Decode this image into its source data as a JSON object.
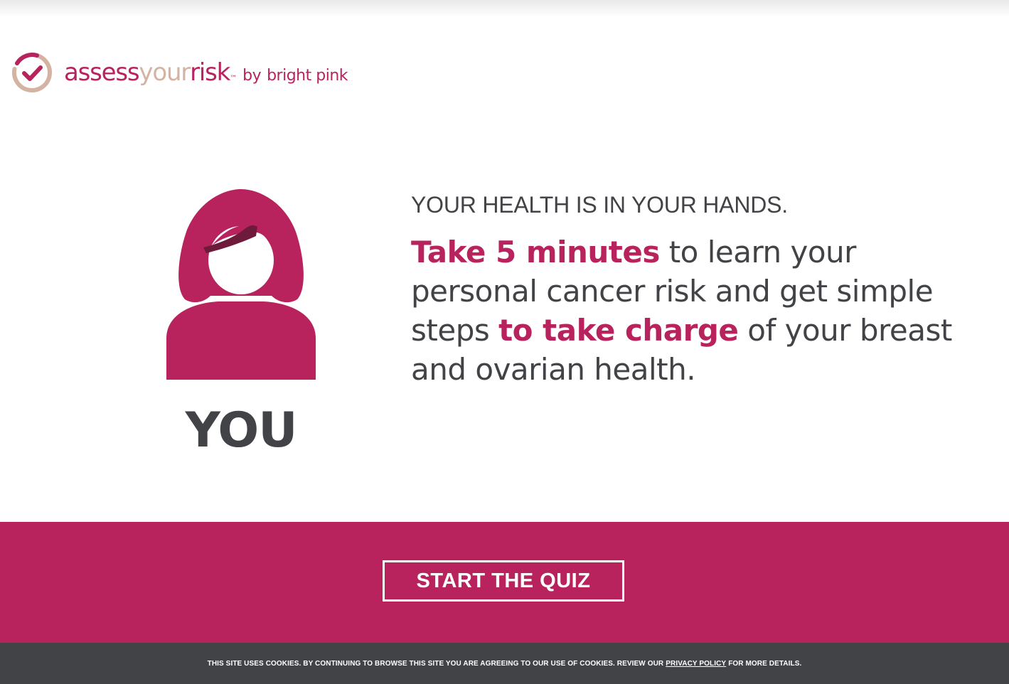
{
  "brand": {
    "assess": "assess",
    "your": "your",
    "risk": "risk",
    "tm": "™",
    "by": "by",
    "partner": "bright pink"
  },
  "colors": {
    "accent": "#b8235d",
    "text_dark": "#424346",
    "logo_tan": "#d4b3a2",
    "footer_bg": "#424346"
  },
  "hero": {
    "avatar_label": "YOU",
    "kicker": "YOUR HEALTH IS IN YOUR HANDS.",
    "headline": {
      "part1": "Take 5 minutes",
      "part2": " to learn your personal cancer risk and get simple steps ",
      "part3": "to take charge",
      "part4": " of your breast and ovarian health."
    }
  },
  "cta": {
    "label": "START THE QUIZ"
  },
  "cookie": {
    "text_before": "THIS SITE USES COOKIES. BY CONTINUING TO BROWSE THIS SITE YOU ARE AGREEING TO OUR USE OF COOKIES. REVIEW OUR",
    "link_label": "PRIVACY POLICY",
    "text_after": "FOR MORE DETAILS."
  }
}
